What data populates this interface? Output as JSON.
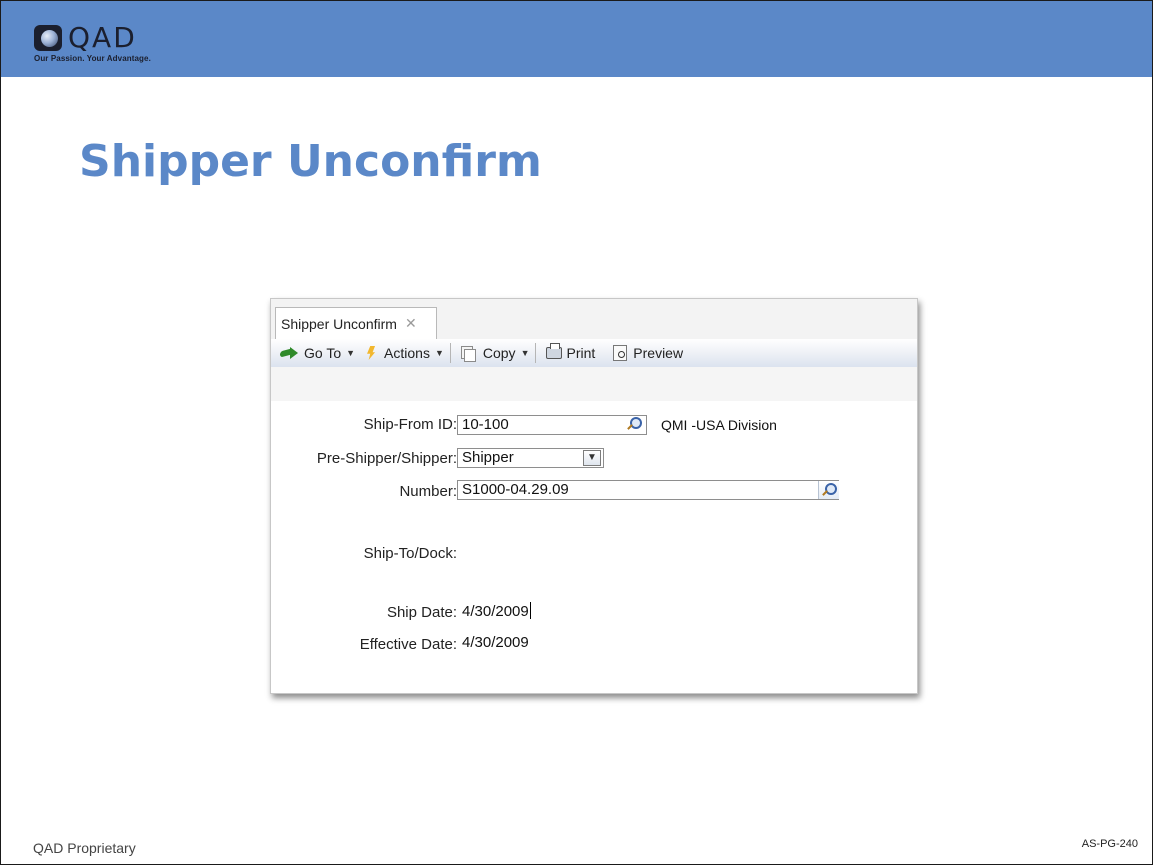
{
  "logo": {
    "text": "QAD",
    "tagline": "Our Passion. Your Advantage."
  },
  "slide": {
    "title": "Shipper Unconfirm",
    "footer_left": "QAD Proprietary",
    "footer_right": "AS-PG-240"
  },
  "colors": {
    "brand_blue": "#5b88c8",
    "logo_dark": "#1b1f2e"
  },
  "app": {
    "tab": {
      "label": "Shipper Unconfirm",
      "close_icon": "close-icon"
    },
    "toolbar": {
      "goto_label": "Go To",
      "actions_label": "Actions",
      "copy_label": "Copy",
      "print_label": "Print",
      "preview_label": "Preview"
    },
    "form": {
      "ship_from_label": "Ship-From ID:",
      "ship_from_value": "10-100",
      "ship_from_desc": "QMI -USA Division",
      "pre_shipper_label": "Pre-Shipper/Shipper:",
      "pre_shipper_value": "Shipper",
      "number_label": "Number:",
      "number_value": "S1000-04.29.09",
      "ship_to_label": "Ship-To/Dock:",
      "ship_date_label": "Ship Date:",
      "ship_date_value": "4/30/2009",
      "effective_date_label": "Effective Date:",
      "effective_date_value": "4/30/2009"
    }
  }
}
